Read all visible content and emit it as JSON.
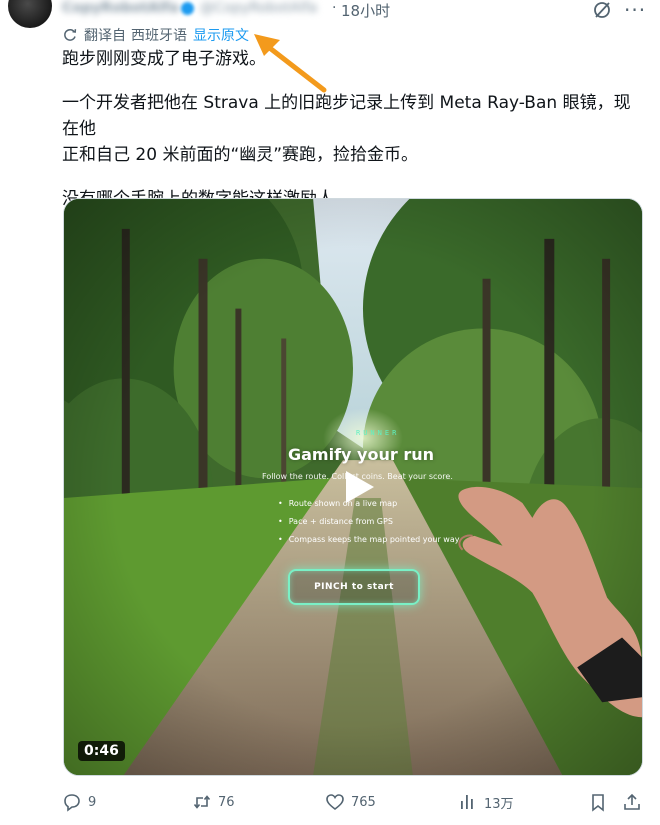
{
  "header": {
    "author_name": "CopyRobotAlfa",
    "author_handle": "@CopyRobotAlfa",
    "separator": "·",
    "time": "18小时"
  },
  "translation": {
    "label": "翻译自",
    "language": "西班牙语",
    "show_original": "显示原文"
  },
  "tweet": {
    "line1": "跑步刚刚变成了电子游戏。",
    "line2": "一个开发者把他在 Strava 上的旧跑步记录上传到 Meta Ray-Ban 眼镜，现在他",
    "line3": "正和自己 20 米前面的“幽灵”赛跑，捡拾金币。",
    "line4": "没有哪个手腕上的数字能这样激励人。"
  },
  "media": {
    "hud_kicker": "RUNNER",
    "hud_title": "Gamify your run",
    "hud_subtitle": "Follow the route. Collect coins. Beat your score.",
    "hud_items": [
      "Route shown on a live map",
      "Pace + distance from GPS",
      "Compass keeps the map pointed your way"
    ],
    "pinch_label": "PINCH to start",
    "duration": "0:46"
  },
  "actions": {
    "replies": "9",
    "retweets": "76",
    "likes": "765",
    "views": "13万"
  },
  "colors": {
    "link": "#1d9bf0",
    "annotation_arrow": "#f39a1c",
    "hud_accent": "#7af0c6",
    "muted_text": "#536471"
  }
}
